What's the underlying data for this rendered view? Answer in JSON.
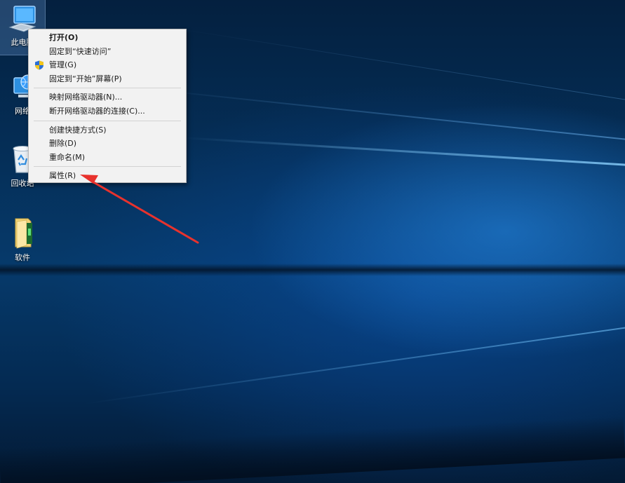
{
  "desktop": {
    "icons": [
      {
        "label": "此电脑",
        "icon": "this-pc-icon"
      },
      {
        "label": "网络",
        "icon": "network-icon"
      },
      {
        "label": "回收站",
        "icon": "recycle-bin-icon"
      },
      {
        "label": "软件",
        "icon": "folder-icon"
      }
    ]
  },
  "context_menu": {
    "items": [
      {
        "label": "打开(O)"
      },
      {
        "label": "固定到“快速访问”"
      },
      {
        "label": "管理(G)",
        "icon": "shield-icon"
      },
      {
        "label": "固定到“开始”屏幕(P)"
      },
      {
        "label": "映射网络驱动器(N)..."
      },
      {
        "label": "断开网络驱动器的连接(C)..."
      },
      {
        "label": "创建快捷方式(S)"
      },
      {
        "label": "删除(D)"
      },
      {
        "label": "重命名(M)"
      },
      {
        "label": "属性(R)"
      }
    ]
  },
  "annotation": {
    "color": "#e8322d"
  }
}
